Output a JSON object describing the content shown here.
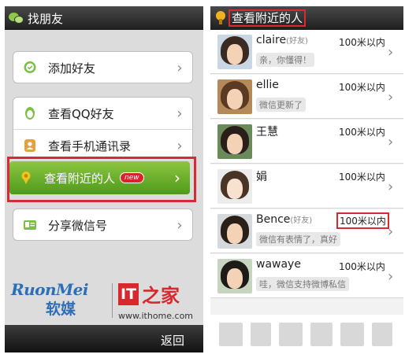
{
  "left": {
    "title": "找朋友",
    "menu": {
      "add_friend": "添加好友",
      "view_qq": "查看QQ好友",
      "view_contacts": "查看手机通讯录",
      "view_nearby": "查看附近的人",
      "new_badge": "new",
      "share_id": "分享微信号"
    },
    "brand1_en": "RuonMei",
    "brand1_cn": "软媒",
    "brand2_it": "IT",
    "brand2_cn": "之家",
    "brand2_url": "www.ithome.com",
    "back": "返回"
  },
  "right": {
    "title": "查看附近的人",
    "people": [
      {
        "name": "claire",
        "tag": "(好友)",
        "status": "亲，你懂得！",
        "distance": "100米以内"
      },
      {
        "name": "ellie",
        "tag": "",
        "status": "微信更新了",
        "distance": "100米以内"
      },
      {
        "name": "王慧",
        "tag": "",
        "status": "",
        "distance": "100米以内"
      },
      {
        "name": "娟",
        "tag": "",
        "status": "",
        "distance": "100米以内"
      },
      {
        "name": "Bence",
        "tag": "(好友)",
        "status": "微信有表情了，真好",
        "distance": "100米以内"
      },
      {
        "name": "wawaye",
        "tag": "",
        "status": "哇，微信支持微博私信",
        "distance": "100米以内"
      }
    ]
  },
  "colors": {
    "accent_green": "#6fb12e",
    "highlight_red": "#d82a35",
    "brand_blue": "#2c6fb8",
    "brand_red": "#d7282e"
  },
  "icons": {
    "app": "wechat-icon",
    "add_friend": "chat-bubble-icon",
    "qq": "qq-penguin-icon",
    "contacts": "contacts-book-icon",
    "nearby": "location-pin-icon",
    "share": "id-card-icon",
    "chevron": "chevron-right-icon"
  }
}
